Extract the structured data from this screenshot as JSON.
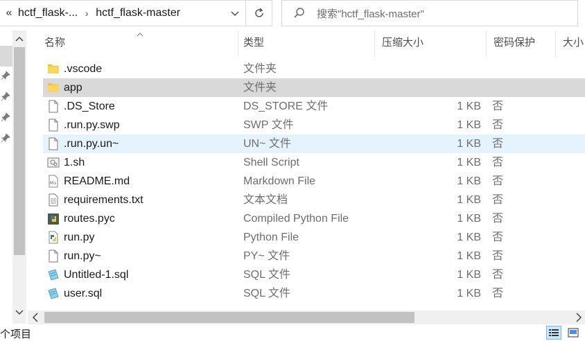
{
  "address": {
    "crumbs": [
      "hctf_flask-...",
      "hctf_flask-master"
    ]
  },
  "search": {
    "placeholder": "搜索\"hctf_flask-master\""
  },
  "columns": {
    "name": "名称",
    "type": "类型",
    "compressed_size": "压缩大小",
    "password": "密码保护",
    "size": "大小"
  },
  "files": [
    {
      "name": ".vscode",
      "type": "文件夹",
      "size": "",
      "protected": "",
      "icon": "folder-icon"
    },
    {
      "name": "app",
      "type": "文件夹",
      "size": "",
      "protected": "",
      "icon": "folder-icon",
      "state": "selected"
    },
    {
      "name": ".DS_Store",
      "type": "DS_STORE 文件",
      "size": "1 KB",
      "protected": "否",
      "icon": "file-icon"
    },
    {
      "name": ".run.py.swp",
      "type": "SWP 文件",
      "size": "1 KB",
      "protected": "否",
      "icon": "file-icon"
    },
    {
      "name": ".run.py.un~",
      "type": "UN~ 文件",
      "size": "1 KB",
      "protected": "否",
      "icon": "file-icon",
      "state": "hover"
    },
    {
      "name": "1.sh",
      "type": "Shell Script",
      "size": "1 KB",
      "protected": "否",
      "icon": "shell-script-icon"
    },
    {
      "name": "README.md",
      "type": "Markdown File",
      "size": "1 KB",
      "protected": "否",
      "icon": "markdown-file-icon"
    },
    {
      "name": "requirements.txt",
      "type": "文本文档",
      "size": "1 KB",
      "protected": "否",
      "icon": "text-file-icon"
    },
    {
      "name": "routes.pyc",
      "type": "Compiled Python File",
      "size": "1 KB",
      "protected": "否",
      "icon": "compiled-python-icon"
    },
    {
      "name": "run.py",
      "type": "Python File",
      "size": "1 KB",
      "protected": "否",
      "icon": "python-file-icon"
    },
    {
      "name": "run.py~",
      "type": "PY~ 文件",
      "size": "1 KB",
      "protected": "否",
      "icon": "file-icon"
    },
    {
      "name": "Untitled-1.sql",
      "type": "SQL 文件",
      "size": "1 KB",
      "protected": "否",
      "icon": "sql-file-icon"
    },
    {
      "name": "user.sql",
      "type": "SQL 文件",
      "size": "1 KB",
      "protected": "否",
      "icon": "sql-file-icon"
    }
  ],
  "status": {
    "item_count": "个项目"
  },
  "colors": {
    "selected_row": "#d9d9d9",
    "hover_row": "#e5f3ff",
    "folder": "#f3c33b",
    "active_view": "#cce8ff"
  }
}
